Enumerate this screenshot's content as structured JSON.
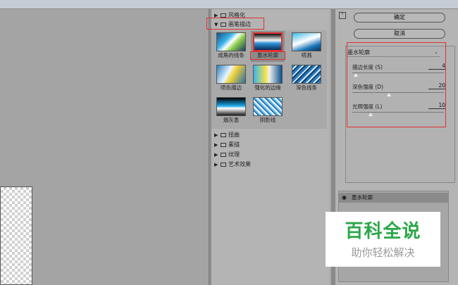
{
  "filter_categories": {
    "stylize": "风格化",
    "brush_strokes": "画笔描边",
    "distort": "扭曲",
    "sketch": "素描",
    "texture": "纹理",
    "artistic": "艺术效果"
  },
  "filters": [
    "成角的线条",
    "墨水轮廓",
    "喷溅",
    "喷色描边",
    "强化的边缘",
    "深色线条",
    "烟灰墨",
    "阴影线"
  ],
  "buttons": {
    "ok": "确定",
    "cancel": "取消"
  },
  "settings": {
    "selected_filter": "墨水轮廓",
    "params": [
      {
        "label": "描边长度 (S)",
        "value": "4",
        "level": 0.04
      },
      {
        "label": "深色强度 (D)",
        "value": "20",
        "level": 0.4
      },
      {
        "label": "光照强度 (L)",
        "value": "10",
        "level": 0.2
      }
    ]
  },
  "layers": {
    "items": [
      "墨水轮廓"
    ]
  },
  "watermark": {
    "line1": "百科全说",
    "line2": "助你轻松解决"
  },
  "colors": {
    "highlight": "#e03030",
    "watermark_green": "#2aa748"
  }
}
